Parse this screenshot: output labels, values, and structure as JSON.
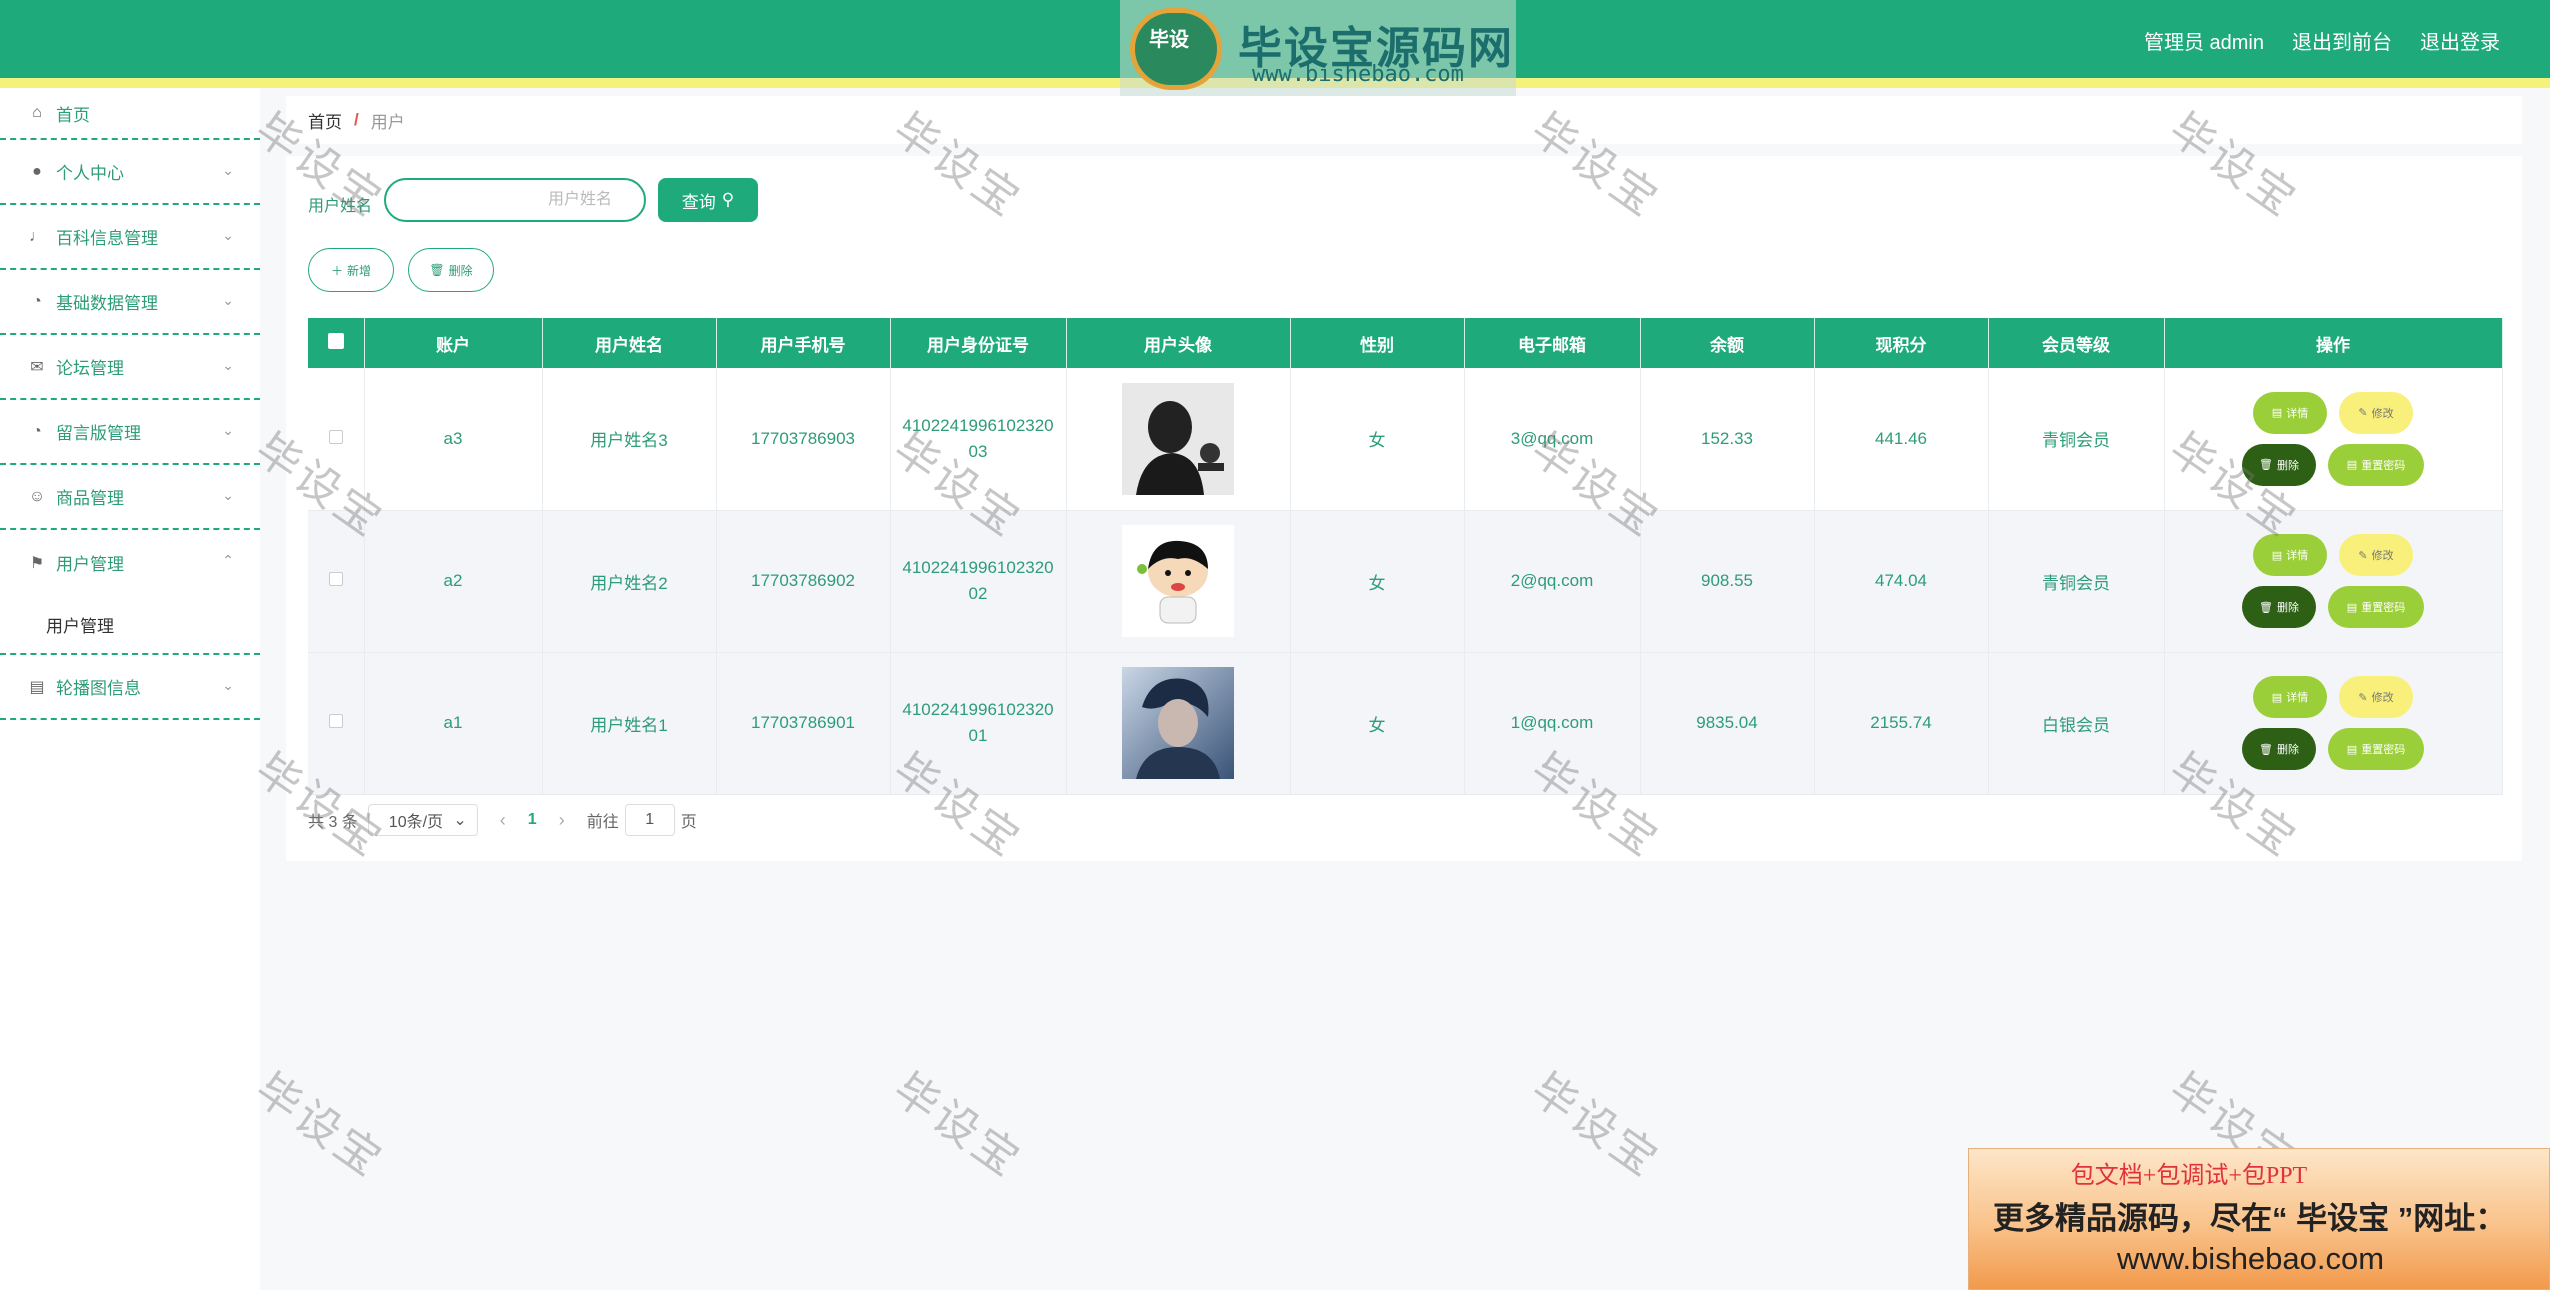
{
  "header": {
    "user_label": "管理员 admin",
    "link_front": "退出到前台",
    "link_logout": "退出登录",
    "logo_badge": "毕设",
    "logo_title": "毕设宝源码网",
    "logo_url": "www.bishebao.com"
  },
  "sidebar": {
    "items": [
      {
        "label": "首页",
        "icon": "home-icon",
        "glyph": "⌂"
      },
      {
        "label": "个人中心",
        "icon": "user-icon",
        "glyph": "👤"
      },
      {
        "label": "百科信息管理",
        "icon": "mic-icon",
        "glyph": "🎙"
      },
      {
        "label": "基础数据管理",
        "icon": "compass-icon",
        "glyph": "◔"
      },
      {
        "label": "论坛管理",
        "icon": "mail-icon",
        "glyph": "✉"
      },
      {
        "label": "留言版管理",
        "icon": "gauge-icon",
        "glyph": "◔"
      },
      {
        "label": "商品管理",
        "icon": "smile-icon",
        "glyph": "☺"
      },
      {
        "label": "用户管理",
        "icon": "flag-icon",
        "glyph": "⚑"
      },
      {
        "label": "轮播图信息",
        "icon": "printer-icon",
        "glyph": "▤"
      }
    ],
    "subitem": "用户管理"
  },
  "breadcrumb": {
    "home": "首页",
    "separator": "/",
    "current": "用户"
  },
  "search": {
    "label": "用户姓名",
    "placeholder": "用户姓名",
    "query_button": "查询"
  },
  "actions": {
    "add": "新增",
    "delete": "删除"
  },
  "table": {
    "headers": [
      "账户",
      "用户姓名",
      "用户手机号",
      "用户身份证号",
      "用户头像",
      "性别",
      "电子邮箱",
      "余额",
      "现积分",
      "会员等级",
      "操作"
    ],
    "rows": [
      {
        "account": "a3",
        "name": "用户姓名3",
        "phone": "17703786903",
        "id_number": "410224199610232003",
        "gender": "女",
        "email": "3@qq.com",
        "balance": "152.33",
        "points": "441.46",
        "level": "青铜会员"
      },
      {
        "account": "a2",
        "name": "用户姓名2",
        "phone": "17703786902",
        "id_number": "410224199610232002",
        "gender": "女",
        "email": "2@qq.com",
        "balance": "908.55",
        "points": "474.04",
        "level": "青铜会员"
      },
      {
        "account": "a1",
        "name": "用户姓名1",
        "phone": "17703786901",
        "id_number": "410224199610232001",
        "gender": "女",
        "email": "1@qq.com",
        "balance": "9835.04",
        "points": "2155.74",
        "level": "白银会员"
      }
    ],
    "ops": {
      "detail": "详情",
      "edit": "修改",
      "delete": "删除",
      "reset": "重置密码"
    }
  },
  "pagination": {
    "total": "共 3 条",
    "page_size": "10条/页",
    "current_page": "1",
    "goto_prefix": "前往",
    "goto_value": "1",
    "goto_suffix": "页"
  },
  "watermark": "毕设宝",
  "ad": {
    "line1": "包文档+包调试+包PPT",
    "line2": "更多精品源码，尽在“ 毕设宝 ”网址：",
    "line3": "www.bishebao.com"
  },
  "colors": {
    "primary": "#1faa7b",
    "accent_stripe": "#f4f27a",
    "detail": "#9bcf3a",
    "edit": "#f8f07a",
    "delete": "#2d5f14",
    "danger_sep": "#e25555"
  }
}
